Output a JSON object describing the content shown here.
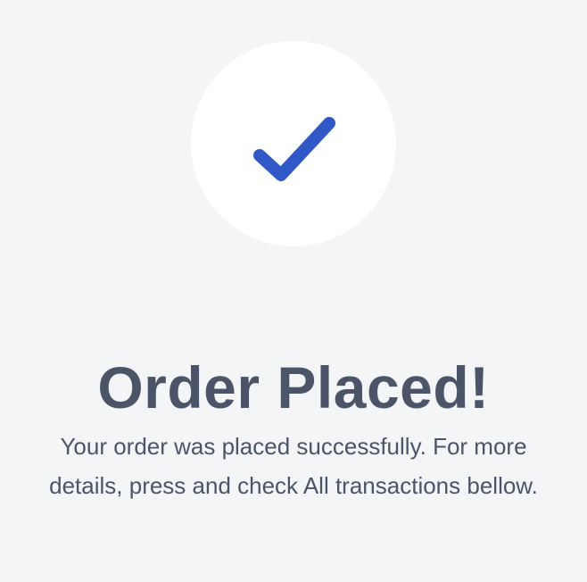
{
  "confirmation": {
    "icon": "checkmark-icon",
    "title": "Order Placed!",
    "message": "Your order was placed successfully. For more details, press and check All transactions bellow."
  },
  "colors": {
    "background": "#f4f5f7",
    "circle": "#ffffff",
    "check": "#3058c7",
    "text": "#4b5567"
  }
}
